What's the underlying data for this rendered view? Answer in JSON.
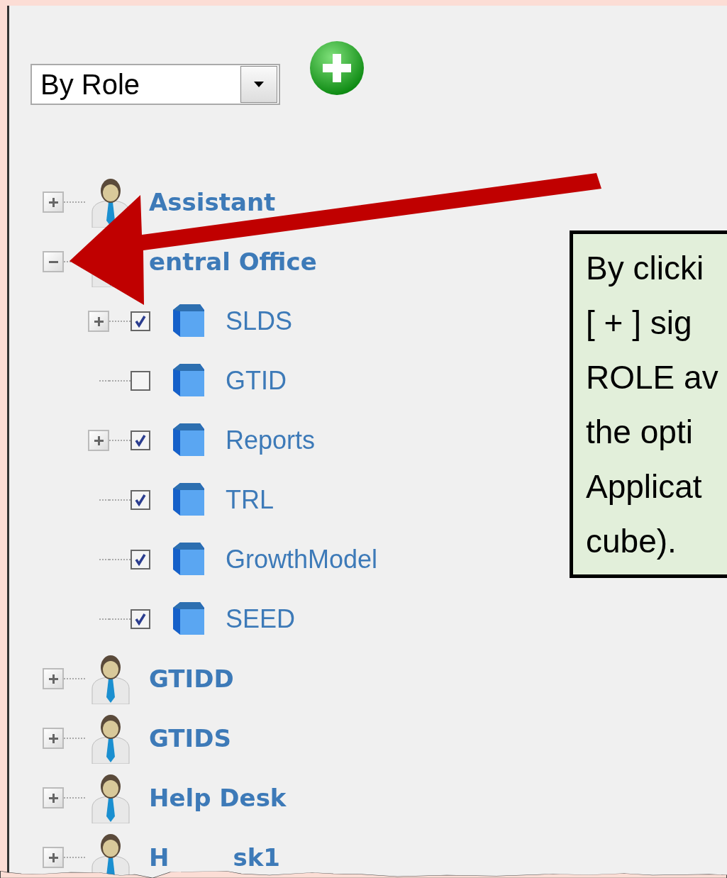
{
  "dropdown": {
    "value": "By Role"
  },
  "tree": [
    {
      "label_parts": [
        "Assistant"
      ],
      "expanded": false
    },
    {
      "label_parts": [
        "entral Office"
      ],
      "expanded": true,
      "children": [
        {
          "label": "SLDS",
          "expandable": true,
          "checked": true
        },
        {
          "label": "GTID",
          "expandable": false,
          "checked": false
        },
        {
          "label": "Reports",
          "expandable": true,
          "checked": true
        },
        {
          "label": "TRL",
          "expandable": false,
          "checked": true
        },
        {
          "label": "GrowthModel",
          "expandable": false,
          "checked": true
        },
        {
          "label": "SEED",
          "expandable": false,
          "checked": true
        }
      ]
    },
    {
      "label_parts": [
        "GTIDD"
      ],
      "expanded": false
    },
    {
      "label_parts": [
        "GTIDS"
      ],
      "expanded": false
    },
    {
      "label_parts": [
        "Help Desk"
      ],
      "expanded": false
    },
    {
      "label_parts": [
        "H",
        "sk1"
      ],
      "expanded": false
    }
  ],
  "callout": {
    "lines": [
      "By clicki",
      "[ + ] sig",
      "ROLE av",
      "the opti",
      "Applicat",
      "cube)."
    ]
  }
}
